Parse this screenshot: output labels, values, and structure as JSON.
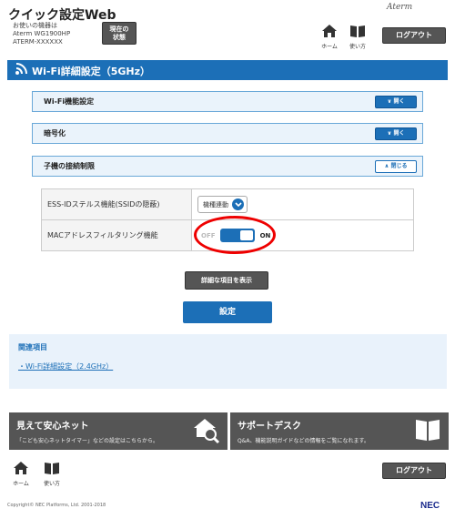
{
  "header": {
    "title": "クイック設定Web",
    "device_caption": "お使いの機器は",
    "device_model": "Aterm WG1900HP",
    "device_serial": "ATERM-XXXXXX",
    "status_button_line1": "現在の",
    "status_button_line2": "状態",
    "brand": "Aterm",
    "home_label": "ホーム",
    "guide_label": "使い方",
    "logout_label": "ログアウト"
  },
  "page": {
    "title": "Wi-Fi詳細設定（5GHz）"
  },
  "accordions": [
    {
      "label": "Wi-Fi機能設定",
      "toggle": "開く",
      "state": "collapsed"
    },
    {
      "label": "暗号化",
      "toggle": "開く",
      "state": "collapsed"
    },
    {
      "label": "子機の接続制限",
      "toggle": "閉じる",
      "state": "expanded"
    }
  ],
  "settings": {
    "ess_id_label": "ESS-IDステルス機能(SSIDの隠蔽)",
    "ess_id_value": "機種連動",
    "mac_filter_label": "MACアドレスフィルタリング機能",
    "mac_filter_off": "OFF",
    "mac_filter_on": "ON",
    "mac_filter_state": "ON"
  },
  "buttons": {
    "show_details": "詳細な項目を表示",
    "save": "設定"
  },
  "related": {
    "heading": "関連項目",
    "link": "Wi-Fi詳細設定（2.4GHz）"
  },
  "promos": [
    {
      "title": "見えて安心ネット",
      "subtitle": "「こども安心ネットタイマー」などの設定はこちらから。",
      "icon": "home-search-icon"
    },
    {
      "title": "サポートデスク",
      "subtitle": "Q&A、機能説明ガイドなどの情報をご覧になれます。",
      "icon": "book-icon"
    }
  ],
  "footer": {
    "home_label": "ホーム",
    "guide_label": "使い方",
    "logout_label": "ログアウト",
    "copyright": "Copyright© NEC Platforms, Ltd. 2001-2018",
    "logo": "NEC"
  },
  "colors": {
    "accent": "#1c6fb7",
    "dark_button": "#555555",
    "highlight_ring": "#ee0000"
  }
}
